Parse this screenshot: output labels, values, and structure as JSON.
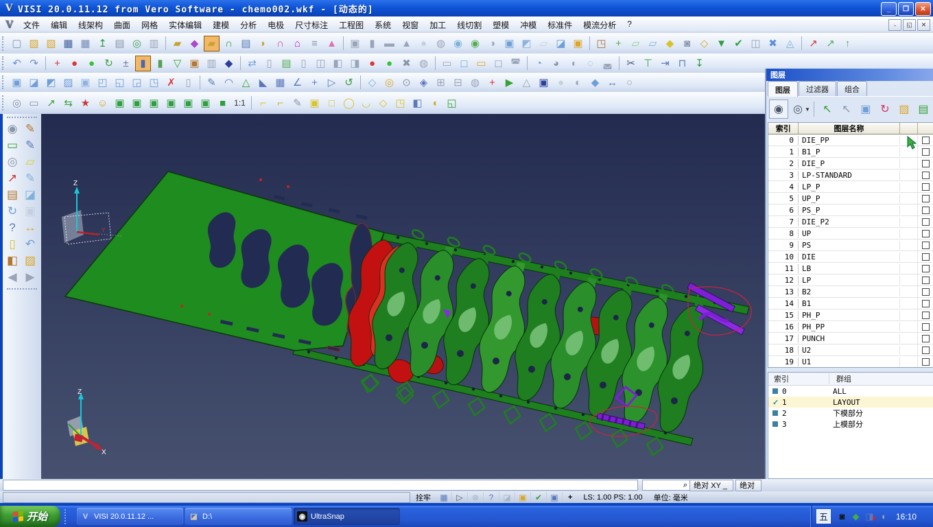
{
  "window": {
    "title": "VISI 20.0.11.12 from Vero Software - chemo002.wkf - [动态的]",
    "app_icon": "V",
    "controls": {
      "minimize": "_",
      "maximize": "❐",
      "close": "✕"
    }
  },
  "menu": {
    "items": [
      "文件",
      "编辑",
      "线架构",
      "曲面",
      "网格",
      "实体编辑",
      "建模",
      "分析",
      "电极",
      "尺寸标注",
      "工程图",
      "系统",
      "视窗",
      "加工",
      "线切割",
      "塑模",
      "冲模",
      "标准件",
      "模流分析",
      "?"
    ],
    "mdi": [
      "-",
      "◱",
      "✕"
    ]
  },
  "toolbars": {
    "row1": [
      {
        "g": "▢",
        "c": "#8494ad",
        "n": "new-file"
      },
      {
        "g": "▨",
        "c": "#d9a62a",
        "n": "open-file"
      },
      {
        "g": "▧",
        "c": "#d9a62a",
        "n": "import-file"
      },
      {
        "g": "▦",
        "c": "#44609f",
        "n": "save"
      },
      {
        "g": "▦",
        "c": "#7589b8",
        "n": "save-as"
      },
      {
        "g": "↥",
        "c": "#2f9e3f",
        "n": "export"
      },
      {
        "g": "▤",
        "c": "#8a96ac",
        "n": "print"
      },
      {
        "g": "◎",
        "c": "#3f9e4f",
        "n": "print-preview"
      },
      {
        "g": "▥",
        "c": "#9aa6bc",
        "n": "split-view"
      },
      "|",
      {
        "g": "▰",
        "c": "#c9a22f"
      },
      {
        "g": "◆",
        "c": "#b046c9"
      },
      {
        "g": "▰",
        "c": "#c9a22f",
        "hl": true
      },
      {
        "g": "∩",
        "c": "#2f9e3f"
      },
      {
        "g": "▤",
        "c": "#5b79ba"
      },
      {
        "g": "◗",
        "c": "#c9a22f"
      },
      {
        "g": "∩",
        "c": "#cf4f9f"
      },
      {
        "g": "⌂",
        "c": "#c318c3"
      },
      {
        "g": "≡",
        "c": "#8a96ac"
      },
      {
        "g": "▲",
        "c": "#e070b1"
      },
      "|",
      {
        "g": "▣",
        "c": "#98a4ba"
      },
      {
        "g": "▮",
        "c": "#98a4ba"
      },
      {
        "g": "▬",
        "c": "#98a4ba"
      },
      {
        "g": "▲",
        "c": "#98a4ba"
      },
      {
        "g": "●",
        "c": "#c6cfdc"
      },
      {
        "g": "◍",
        "c": "#98a4ba"
      },
      {
        "g": "◉",
        "c": "#7fb2da"
      },
      {
        "g": "◉",
        "c": "#55ad55"
      },
      {
        "g": "◑",
        "c": "#98a4ba"
      },
      {
        "g": "▣",
        "c": "#6f9fd9"
      },
      {
        "g": "◩",
        "c": "#8fb2e1"
      },
      {
        "g": "▱",
        "c": "#c6cfdc"
      },
      {
        "g": "◪",
        "c": "#6f9fd9"
      },
      {
        "g": "▣",
        "c": "#d9a62a"
      },
      "|",
      {
        "g": "◳",
        "c": "#a9753d"
      },
      {
        "g": "+",
        "c": "#55ad55"
      },
      {
        "g": "▱",
        "c": "#8fcf8f"
      },
      {
        "g": "▱",
        "c": "#7fb2da"
      },
      {
        "g": "◆",
        "c": "#d9c22a"
      },
      {
        "g": "◙",
        "c": "#8a96ac"
      },
      {
        "g": "◇",
        "c": "#d9a62a"
      },
      {
        "g": "▼",
        "c": "#2f9e3f"
      },
      {
        "g": "✔",
        "c": "#2f9e3f"
      },
      {
        "g": "◫",
        "c": "#98a4ba"
      },
      {
        "g": "✖",
        "c": "#5b8fd9"
      },
      {
        "g": "◬",
        "c": "#7fb2da"
      },
      "|",
      {
        "g": "↗",
        "c": "#cc3636"
      },
      {
        "g": "↗",
        "c": "#55ad55"
      },
      {
        "g": "↑",
        "c": "#55ad55"
      }
    ],
    "row2": [
      {
        "g": "↶",
        "c": "#6f8fd2",
        "n": "undo"
      },
      {
        "g": "↷",
        "c": "#6f8fd2",
        "n": "redo"
      },
      "|",
      {
        "g": "+",
        "c": "#cc3636"
      },
      {
        "g": "●",
        "c": "#d93636"
      },
      {
        "g": "●",
        "c": "#39c039"
      },
      {
        "g": "↻",
        "c": "#39a039"
      },
      {
        "g": "±",
        "c": "#6b7a94"
      },
      {
        "g": "▮",
        "c": "#4a67b2",
        "hl": true
      },
      {
        "g": "▮",
        "c": "#55a055"
      },
      {
        "g": "▽",
        "c": "#39a039"
      },
      {
        "g": "▣",
        "c": "#b5762f"
      },
      {
        "g": "▥",
        "c": "#98a4ba"
      },
      {
        "g": "◆",
        "c": "#2a3f9b"
      },
      "|",
      {
        "g": "⇄",
        "c": "#6f9fd9"
      },
      {
        "g": "▯",
        "c": "#98a4ba"
      },
      {
        "g": "▤",
        "c": "#55ad55"
      },
      {
        "g": "▯",
        "c": "#98a4ba"
      },
      {
        "g": "◫",
        "c": "#98a4ba"
      },
      {
        "g": "◧",
        "c": "#98a4ba"
      },
      {
        "g": "◨",
        "c": "#98a4ba"
      },
      {
        "g": "●",
        "c": "#d93636"
      },
      {
        "g": "●",
        "c": "#39c039"
      },
      {
        "g": "✖",
        "c": "#8a96ac"
      },
      {
        "g": "◍",
        "c": "#98a4ba"
      },
      "|",
      {
        "g": "▭",
        "c": "#98a4ba"
      },
      {
        "g": "◻",
        "c": "#7fb2da"
      },
      {
        "g": "▭",
        "c": "#d9a62a"
      },
      {
        "g": "◻",
        "c": "#98a4ba"
      },
      {
        "g": "◚",
        "c": "#98a4ba"
      },
      "|",
      {
        "g": "◔",
        "c": "#6f9fd9"
      },
      {
        "g": "◕",
        "c": "#8a96ac"
      },
      {
        "g": "◖",
        "c": "#98a4ba"
      },
      {
        "g": "◌",
        "c": "#7fb2da"
      },
      {
        "g": "◛",
        "c": "#98a4ba"
      },
      "|",
      {
        "g": "✂",
        "c": "#4a5a78"
      },
      {
        "g": "⊤",
        "c": "#2f9e3f"
      },
      {
        "g": "⇥",
        "c": "#5b79ba"
      },
      {
        "g": "⊓",
        "c": "#5b79ba"
      },
      {
        "g": "↧",
        "c": "#2f9e3f"
      }
    ],
    "row3": [
      {
        "g": "▣",
        "c": "#6f9fd9"
      },
      {
        "g": "◪",
        "c": "#6f9fd9"
      },
      {
        "g": "◩",
        "c": "#6f9fd9"
      },
      {
        "g": "▨",
        "c": "#6f9fd9"
      },
      {
        "g": "▣",
        "c": "#8fb2e1"
      },
      {
        "g": "◰",
        "c": "#6f9fd9"
      },
      {
        "g": "◱",
        "c": "#6f9fd9"
      },
      {
        "g": "◲",
        "c": "#6f9fd9"
      },
      {
        "g": "◳",
        "c": "#6f9fd9"
      },
      {
        "g": "✗",
        "c": "#d93636"
      },
      {
        "g": "▯",
        "c": "#98a4ba"
      },
      "|",
      {
        "g": "✎",
        "c": "#5b79ba"
      },
      {
        "g": "◠",
        "c": "#5b79ba"
      },
      {
        "g": "△",
        "c": "#39a039"
      },
      {
        "g": "◣",
        "c": "#5b79ba"
      },
      {
        "g": "▦",
        "c": "#5b79ba"
      },
      {
        "g": "∠",
        "c": "#5b79ba"
      },
      {
        "g": "+",
        "c": "#5b79ba"
      },
      {
        "g": "▷",
        "c": "#5b79ba"
      },
      {
        "g": "↺",
        "c": "#39a039"
      },
      "|",
      {
        "g": "◇",
        "c": "#7fb2da"
      },
      {
        "g": "◎",
        "c": "#d9a62a"
      },
      {
        "g": "⊙",
        "c": "#8a96ac"
      },
      {
        "g": "◈",
        "c": "#5b79ba"
      },
      {
        "g": "⊞",
        "c": "#98a4ba"
      },
      {
        "g": "⊟",
        "c": "#98a4ba"
      },
      {
        "g": "◍",
        "c": "#98a4ba"
      },
      {
        "g": "+",
        "c": "#d93636"
      },
      {
        "g": "▶",
        "c": "#39a039"
      },
      {
        "g": "△",
        "c": "#98a4ba"
      },
      {
        "g": "▣",
        "c": "#2a3f9b"
      },
      {
        "g": "●",
        "c": "#c6cfdc"
      },
      {
        "g": "◐",
        "c": "#98a4ba"
      },
      {
        "g": "◆",
        "c": "#6f9fd9"
      },
      {
        "g": "↔",
        "c": "#5b79ba"
      },
      {
        "g": "○",
        "c": "#98a4ba"
      }
    ],
    "row4": [
      {
        "g": "◎",
        "c": "#8a96ac",
        "n": "zoom-in"
      },
      {
        "g": "▭",
        "c": "#8a96ac",
        "n": "zoom-window"
      },
      {
        "g": "↗",
        "c": "#39a039"
      },
      {
        "g": "⇆",
        "c": "#39a039"
      },
      {
        "g": "★",
        "c": "#cc3636"
      },
      {
        "g": "☺",
        "c": "#d9a62a",
        "n": "shading-smiley"
      },
      {
        "g": "▣",
        "c": "#2f9e3f",
        "n": "view-iso-1"
      },
      {
        "g": "▣",
        "c": "#2f9e3f",
        "n": "view-iso-2"
      },
      {
        "g": "▣",
        "c": "#2f9e3f",
        "n": "view-front"
      },
      {
        "g": "▣",
        "c": "#2f9e3f",
        "n": "view-back"
      },
      {
        "g": "▣",
        "c": "#2f9e3f",
        "n": "view-left"
      },
      {
        "g": "▣",
        "c": "#2f9e3f",
        "n": "view-right"
      },
      {
        "g": "■",
        "c": "#2f9e3f",
        "n": "view-solid"
      },
      {
        "g": "1:1",
        "c": "#333",
        "sm": true,
        "n": "zoom-1-1"
      },
      "|",
      {
        "g": "⌐",
        "c": "#d9c22a"
      },
      {
        "g": "⌐",
        "c": "#c9b22a"
      },
      {
        "g": "✎",
        "c": "#8a96ac"
      },
      {
        "g": "▣",
        "c": "#d9c22a"
      },
      {
        "g": "□",
        "c": "#d9c22a"
      },
      {
        "g": "◯",
        "c": "#d9c22a"
      },
      {
        "g": "◡",
        "c": "#d9c22a"
      },
      {
        "g": "◇",
        "c": "#d9c22a"
      },
      {
        "g": "◳",
        "c": "#d9c22a"
      },
      {
        "g": "◧",
        "c": "#5b79ba"
      },
      {
        "g": "◖",
        "c": "#d9a62a"
      },
      {
        "g": "◱",
        "c": "#39a039"
      }
    ]
  },
  "left_toolbar": {
    "items": [
      {
        "g": "◉",
        "c": "#8a96ac",
        "n": "zoom-select"
      },
      {
        "g": "✎",
        "c": "#b5762f",
        "n": "edit-sketch"
      },
      {
        "g": "▭",
        "c": "#39a039",
        "n": "frame-select"
      },
      {
        "g": "✎",
        "c": "#5b79ba",
        "n": "sketch"
      },
      {
        "g": "◎",
        "c": "#8a96ac",
        "n": "zoom-solid"
      },
      {
        "g": "▱",
        "c": "#d9d22a",
        "n": "profile"
      },
      {
        "g": "↗",
        "c": "#cc3636",
        "n": "workplane"
      },
      {
        "g": "✎",
        "c": "#7fb2da",
        "n": "curve-edit"
      },
      {
        "g": "▤",
        "c": "#b5762f",
        "n": "attributes"
      },
      {
        "g": "◪",
        "c": "#7fb2da",
        "n": "window-tile"
      },
      {
        "g": "↻",
        "c": "#6f9fd9",
        "n": "refresh"
      },
      {
        "g": "▣",
        "c": "#c6cfdc",
        "n": "solid-cube"
      },
      {
        "g": "?",
        "c": "#5b79ba",
        "n": "help"
      },
      {
        "g": "↔",
        "c": "#d9a62a",
        "n": "dimension"
      },
      {
        "g": "▯",
        "c": "#d9c22a",
        "n": "delete"
      },
      {
        "g": "↶",
        "c": "#6f9fd9",
        "n": "undo-view"
      },
      {
        "g": "◧",
        "c": "#b5762f",
        "n": "settings"
      },
      {
        "g": "▨",
        "c": "#d9a62a",
        "n": "folder-export"
      },
      {
        "g": "◀",
        "c": "#9aa4b8",
        "n": "back"
      },
      {
        "g": "▶",
        "c": "#9aa4b8",
        "n": "forward"
      }
    ]
  },
  "viewport": {
    "axis1": {
      "z": "Z",
      "y": "Y"
    },
    "axis2": {
      "z": "Z",
      "x": "X"
    }
  },
  "layers_panel": {
    "title": "图层",
    "tabs": [
      {
        "label": "图层",
        "active": true
      },
      {
        "label": "过滤器",
        "active": false
      },
      {
        "label": "组合",
        "active": false
      }
    ],
    "toolbar": [
      {
        "g": "◉",
        "c": "#445566",
        "n": "visibility-toggle",
        "pressed": true
      },
      {
        "g": "◎",
        "c": "#445566",
        "n": "zoom-layer",
        "drop": true
      },
      "|",
      {
        "g": "↖",
        "c": "#39a039",
        "n": "select-layer"
      },
      {
        "g": "↖",
        "c": "#8a96ac",
        "n": "select-visible"
      },
      {
        "g": "▣",
        "c": "#6f9fd9",
        "n": "layer-stack"
      },
      {
        "g": "↻",
        "c": "#cc3366",
        "n": "refresh-visibility"
      },
      {
        "g": "▨",
        "c": "#d9a62a",
        "n": "edit-layer"
      },
      {
        "g": "▤",
        "c": "#39a039",
        "n": "layer-list"
      }
    ],
    "table": {
      "headers": [
        "索引",
        "图层名称"
      ],
      "rows": [
        {
          "index": "0",
          "name": "DIE_PP"
        },
        {
          "index": "1",
          "name": "B1_P"
        },
        {
          "index": "2",
          "name": "DIE_P"
        },
        {
          "index": "3",
          "name": "LP-STANDARD"
        },
        {
          "index": "4",
          "name": "LP_P"
        },
        {
          "index": "5",
          "name": "UP_P"
        },
        {
          "index": "6",
          "name": "PS_P"
        },
        {
          "index": "7",
          "name": "DIE_P2"
        },
        {
          "index": "8",
          "name": "UP"
        },
        {
          "index": "9",
          "name": "PS"
        },
        {
          "index": "10",
          "name": "DIE"
        },
        {
          "index": "11",
          "name": "LB"
        },
        {
          "index": "12",
          "name": "LP"
        },
        {
          "index": "13",
          "name": "B2"
        },
        {
          "index": "14",
          "name": "B1"
        },
        {
          "index": "15",
          "name": "PH_P"
        },
        {
          "index": "16",
          "name": "PH_PP"
        },
        {
          "index": "17",
          "name": "PUNCH"
        },
        {
          "index": "18",
          "name": "U2"
        },
        {
          "index": "19",
          "name": "U1"
        }
      ]
    },
    "groups": {
      "headers": [
        "索引",
        "群组"
      ],
      "rows": [
        {
          "index": "0",
          "name": "ALL",
          "mark": "square",
          "selected": false
        },
        {
          "index": "1",
          "name": "LAYOUT",
          "mark": "check",
          "selected": true
        },
        {
          "index": "2",
          "name": "下模部分",
          "mark": "square",
          "selected": false
        },
        {
          "index": "3",
          "name": "上模部分",
          "mark": "square",
          "selected": false
        }
      ]
    }
  },
  "status": {
    "search_icon": "⌕",
    "coord_btn1": "绝对 XY _",
    "coord_btn2": "绝对",
    "snap_label": "拴牢",
    "icons": [
      {
        "g": "▦",
        "c": "#5b79ba",
        "n": "grid-snap"
      },
      {
        "g": "▷",
        "c": "#556",
        "n": "cursor-mode"
      },
      {
        "g": "⊗",
        "c": "#aab4c8",
        "n": "link-mode"
      },
      {
        "g": "?",
        "c": "#5b79ba",
        "n": "context-help"
      },
      {
        "g": "◪",
        "c": "#aab4c8",
        "n": "layer-state"
      },
      {
        "g": "▣",
        "c": "#d9a62a",
        "n": "box-mode"
      },
      {
        "g": "✔",
        "c": "#39a039",
        "n": "validate"
      },
      {
        "g": "▣",
        "c": "#5b79ba",
        "n": "monitor"
      }
    ],
    "plus": "+",
    "scale": "LS: 1.00 PS: 1.00",
    "units": "单位: 毫米"
  },
  "taskbar": {
    "start": "开始",
    "tasks": [
      {
        "label": "VISI 20.0.11.12 ...",
        "icon": "V",
        "ic": "#cfd8ea",
        "ibg": "transparent",
        "pressed": false
      },
      {
        "label": "D:\\",
        "icon": "◪",
        "ic": "#d9c9a0",
        "ibg": "transparent",
        "pressed": false
      },
      {
        "label": "UltraSnap",
        "icon": "◉",
        "ic": "#eee",
        "ibg": "#111",
        "pressed": true
      }
    ],
    "tray": {
      "ime": "五",
      "icons": [
        {
          "g": "◙",
          "c": "#111",
          "n": "ultrasnap-tray-icon"
        },
        {
          "g": "◆",
          "c": "#3fae49",
          "n": "security-shield-icon"
        },
        {
          "g": "◨",
          "c": "#5b79ba",
          "ov": "✗",
          "oc": "#d22",
          "n": "network-disconnected-icon"
        },
        {
          "g": "◖",
          "c": "#9aa4b8",
          "n": "volume-icon"
        }
      ],
      "clock": "16:10"
    }
  }
}
